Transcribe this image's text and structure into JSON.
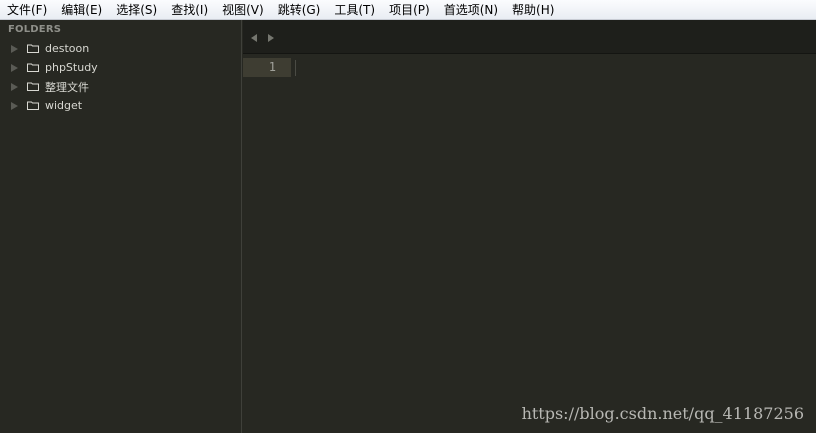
{
  "menubar": {
    "items": [
      {
        "label": "文件(F)"
      },
      {
        "label": "编辑(E)"
      },
      {
        "label": "选择(S)"
      },
      {
        "label": "查找(I)"
      },
      {
        "label": "视图(V)"
      },
      {
        "label": "跳转(G)"
      },
      {
        "label": "工具(T)"
      },
      {
        "label": "项目(P)"
      },
      {
        "label": "首选项(N)"
      },
      {
        "label": "帮助(H)"
      }
    ]
  },
  "sidebar": {
    "header": "FOLDERS",
    "folders": [
      {
        "name": "destoon",
        "icon": "folder-icon"
      },
      {
        "name": "phpStudy",
        "icon": "folder-icon"
      },
      {
        "name": "整理文件",
        "icon": "folder-icon"
      },
      {
        "name": "widget",
        "icon": "folder-icon"
      }
    ]
  },
  "editor": {
    "line_number": "1"
  },
  "watermark": "https://blog.csdn.net/qq_41187256",
  "colors": {
    "editor_bg": "#272822",
    "tabbar_bg": "#1e1f1b",
    "current_line": "#3e3d32",
    "menubar_bg": "#f0f3f8"
  }
}
